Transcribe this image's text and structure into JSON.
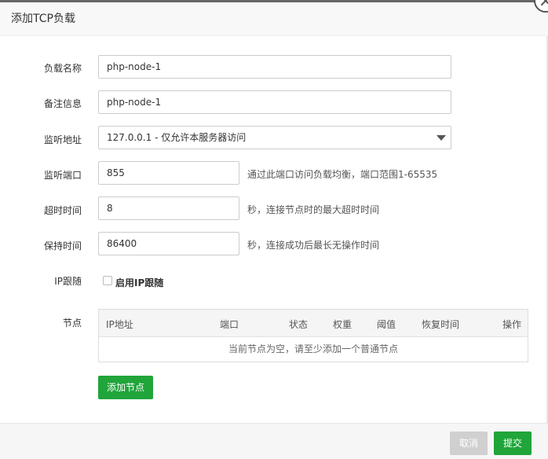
{
  "dialog": {
    "title": "添加TCP负载"
  },
  "form": {
    "name": {
      "label": "负载名称",
      "value": "php-node-1"
    },
    "remark": {
      "label": "备注信息",
      "value": "php-node-1"
    },
    "listen_addr": {
      "label": "监听地址",
      "value": "127.0.0.1 - 仅允许本服务器访问"
    },
    "listen_port": {
      "label": "监听端口",
      "value": "855",
      "hint": "通过此端口访问负载均衡，端口范围1-65535"
    },
    "timeout": {
      "label": "超时时间",
      "value": "8",
      "hint": "秒，连接节点时的最大超时时间"
    },
    "keepalive": {
      "label": "保持时间",
      "value": "86400",
      "hint": "秒，连接成功后最长无操作时间"
    },
    "ip_follow": {
      "label": "IP跟随",
      "checkbox_label": "启用IP跟随",
      "checked": false
    },
    "nodes": {
      "label": "节点",
      "columns": [
        "IP地址",
        "端口",
        "状态",
        "权重",
        "阈值",
        "恢复时间",
        "操作"
      ],
      "empty_text": "当前节点为空，请至少添加一个普通节点",
      "add_button": "添加节点"
    }
  },
  "footer": {
    "cancel_label": "取消",
    "submit_label": "提交"
  },
  "colors": {
    "primary": "#20a53a",
    "disabled": "#d0d0d0"
  }
}
